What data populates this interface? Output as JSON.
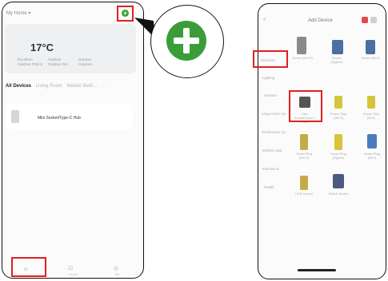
{
  "left_screen": {
    "home_title": "My Home ▾",
    "add_button": "+",
    "weather": {
      "temperature": "17°C",
      "labels": [
        "Excellent",
        "Outdoor",
        "Outdoor"
      ],
      "sublabels": [
        "Outdoor PM2.5",
        "Outdoor RH",
        "Outdoor..."
      ]
    },
    "tabs": [
      "All Devices",
      "Living Room",
      "Master Bedr...",
      "···"
    ],
    "device_name": "Mini Socket/Type-C Hub",
    "nav": [
      {
        "icon": "home-icon",
        "glyph": "⌂",
        "label": ""
      },
      {
        "icon": "scene-icon",
        "glyph": "☑",
        "label": "Scene"
      },
      {
        "icon": "me-icon",
        "glyph": "◎",
        "label": "Me"
      }
    ]
  },
  "zoom": {
    "plus": "+"
  },
  "right_screen": {
    "title": "Add Device",
    "back": "<",
    "categories": [
      "Electrical",
      "Lighting",
      "Sensors",
      "Large Home Ap.",
      "Small Home Ap.",
      "Kitchen Appl.",
      "Exercise &",
      "Health"
    ],
    "devices": [
      {
        "label": "Socket (Wi-Fi)",
        "color": "#8a8a8a"
      },
      {
        "label": "Socket (Zigbee)",
        "color": "#4a6fa5"
      },
      {
        "label": "Socket (BLE)",
        "color": "#4a6fa5"
      },
      {
        "label": "Mini Socket/Type-C Hub",
        "color": "#555555"
      },
      {
        "label": "Power Strip (Wi-Fi)",
        "color": "#d4c53a"
      },
      {
        "label": "Power Strip (BLE)",
        "color": "#d4c53a"
      },
      {
        "label": "Smart Plug (Wi-Fi)",
        "color": "#c8a94a"
      },
      {
        "label": "Smart Plug (Zigbee)",
        "color": "#d4c53a"
      },
      {
        "label": "Smart Plug (BLE)",
        "color": "#4a7bc0"
      },
      {
        "label": "USB Socket",
        "color": "#c8a94a"
      },
      {
        "label": "Switch Socket",
        "color": "#4a5a80"
      }
    ]
  }
}
